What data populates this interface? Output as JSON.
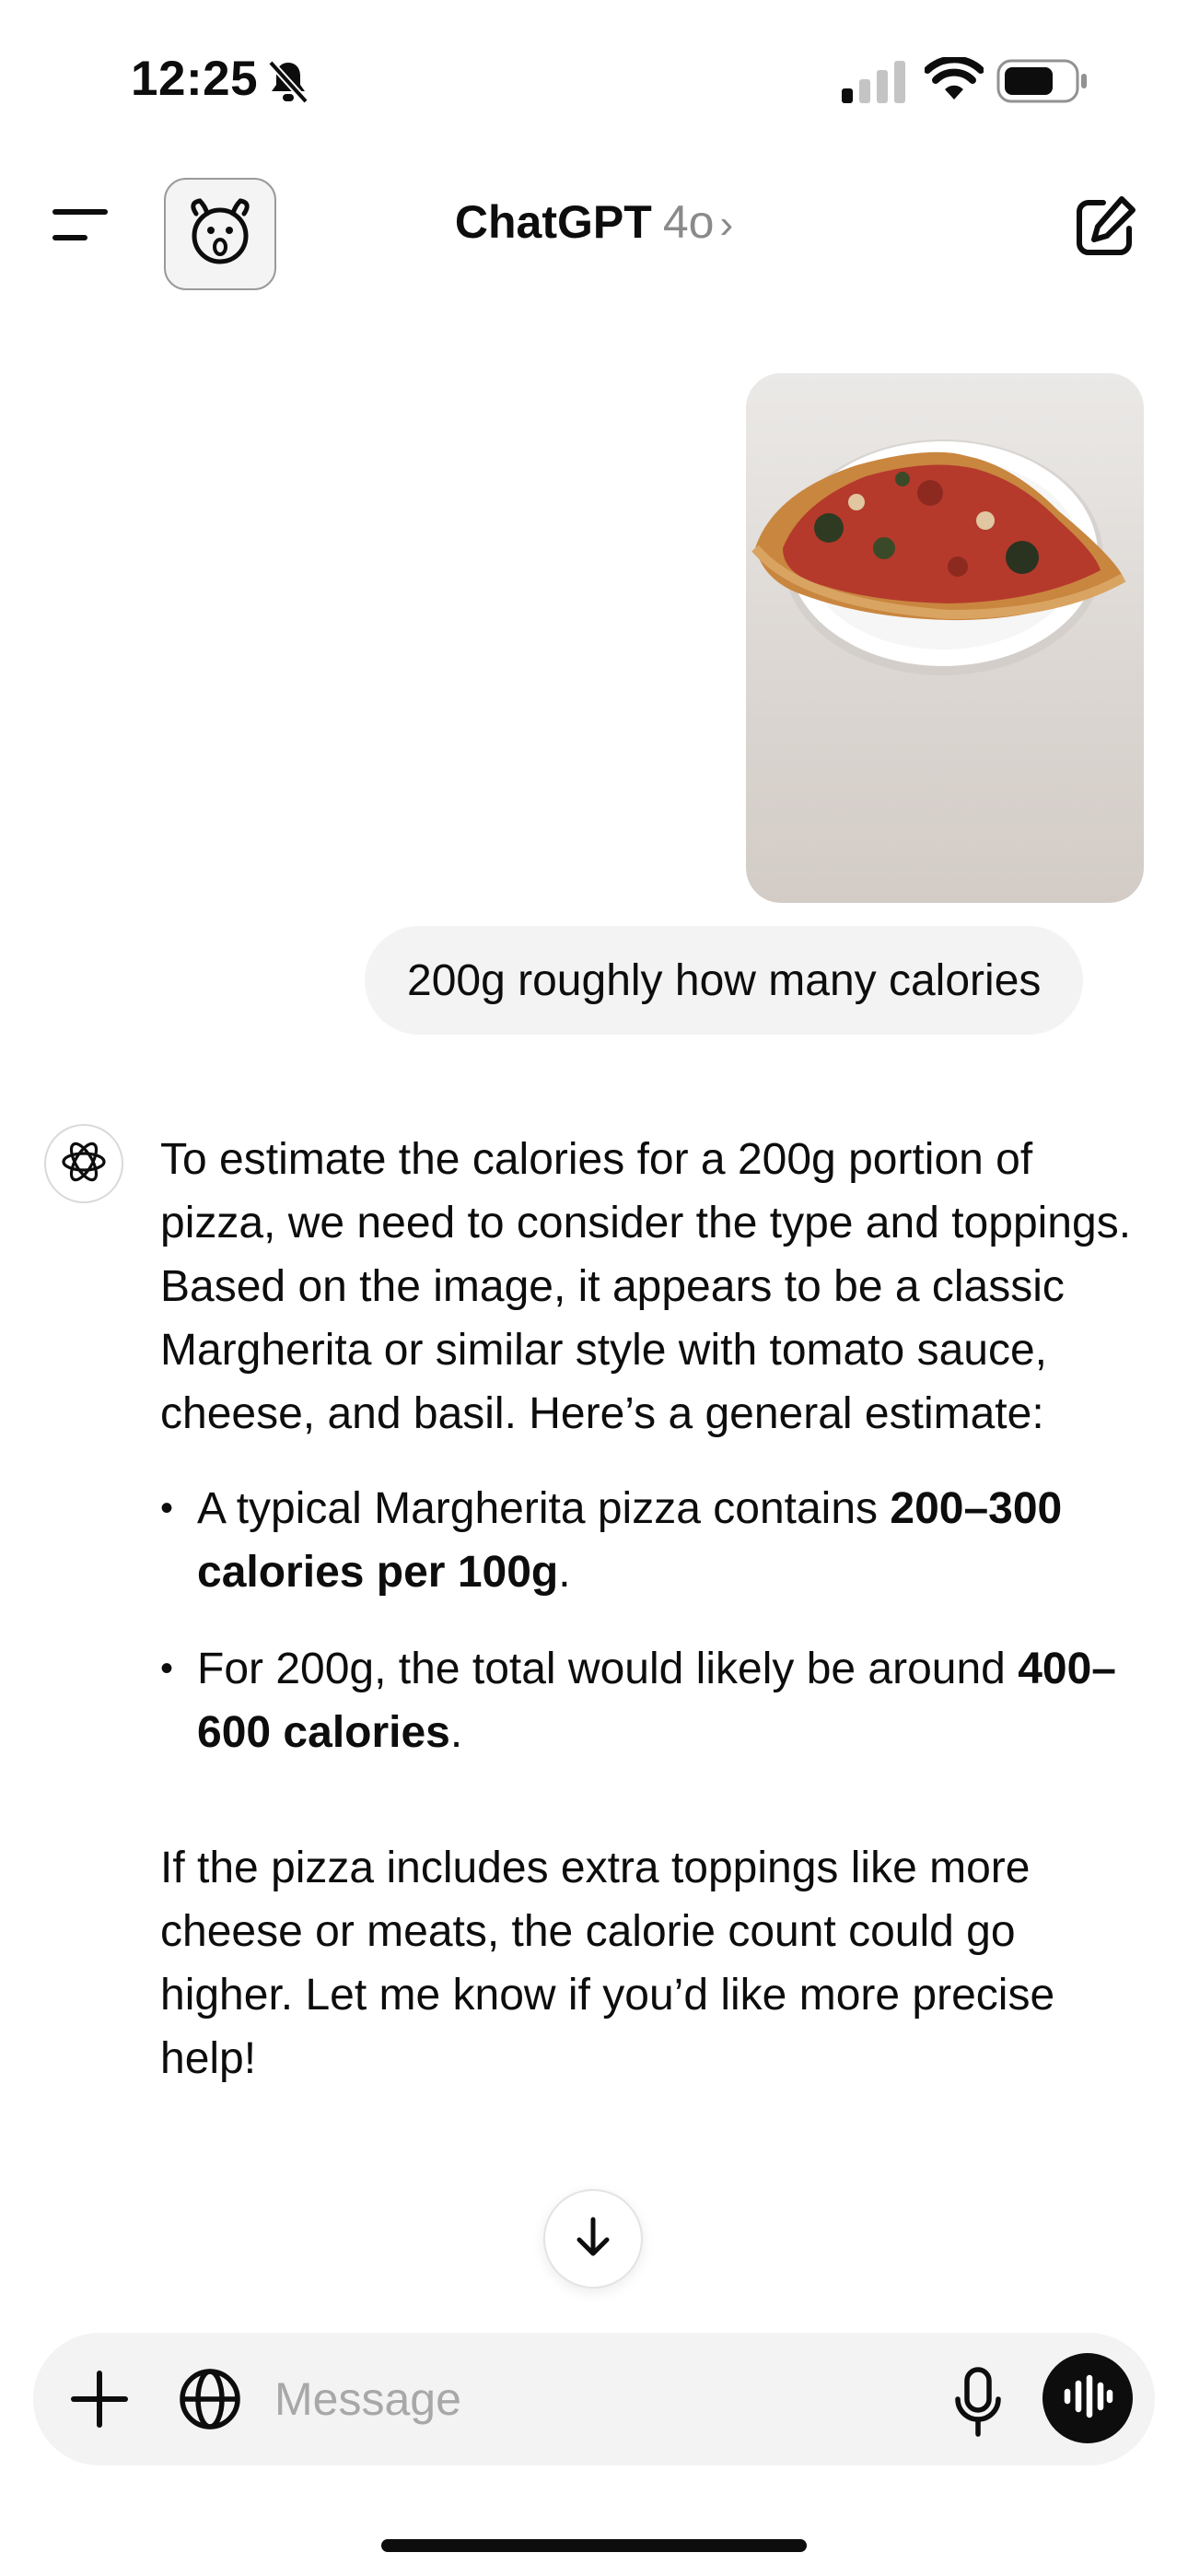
{
  "status_bar": {
    "time": "12:25"
  },
  "nav": {
    "title": "ChatGPT",
    "model": "4o",
    "chevron": "›"
  },
  "conversation": {
    "user_image": {
      "alt": "Photo of a pizza slice on a white plate"
    },
    "user_message": "200g roughly how many calories",
    "assistant": {
      "intro": "To estimate the calories for a 200g portion of pizza, we need to consider the type and toppings. Based on the image, it appears to be a classic Margherita or similar style with tomato sauce, cheese, and basil. Here’s a general estimate:",
      "bullets": [
        {
          "text": "A typical Margherita pizza contains ",
          "bold": "200–300 calories per 100g",
          "after": "."
        },
        {
          "text": "For 200g, the total would likely be around ",
          "bold": "400–600 calories",
          "after": "."
        }
      ],
      "closing": "If the pizza includes extra toppings like more cheese or meats, the calorie count could go higher. Let me know if you’d like more precise help!"
    }
  },
  "composer": {
    "placeholder": "Message"
  },
  "icons": {
    "menu": "menu-icon",
    "avatar": "dog-face-icon",
    "new_chat": "compose-icon",
    "assistant": "openai-logo-icon",
    "scroll_down": "arrow-down-icon",
    "plus": "plus-icon",
    "globe": "globe-icon",
    "mic": "microphone-icon",
    "voice": "voice-wave-icon"
  }
}
